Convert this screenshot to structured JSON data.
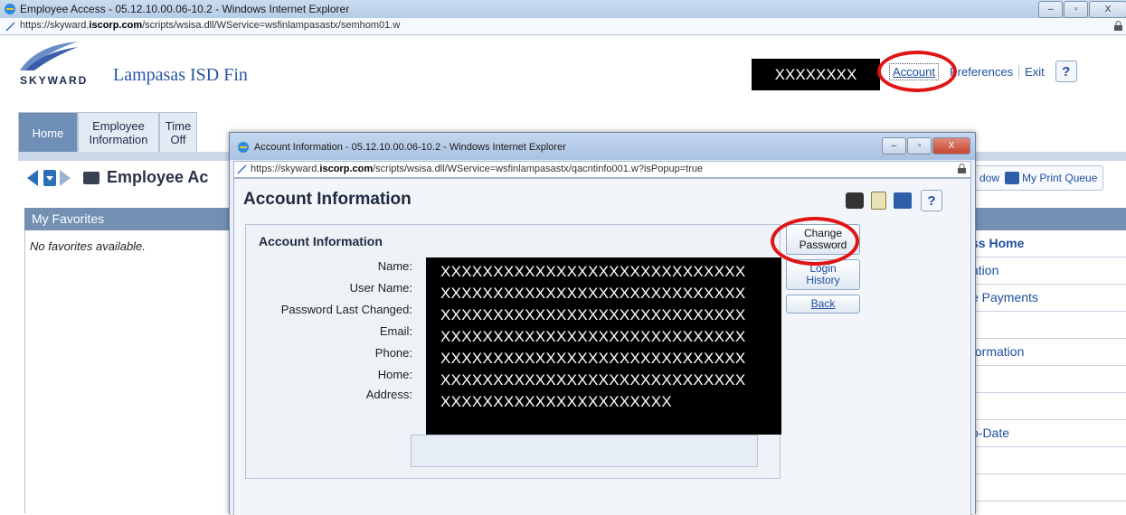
{
  "browser": {
    "window_title": "Employee Access - 05.12.10.00.06-10.2 - Windows Internet Explorer",
    "url_prefix": "https://skyward.",
    "url_host": "iscorp.com",
    "url_rest": "/scripts/wsisa.dll/WService=wsfinlampasastx/semhom01.w",
    "minimize": "–",
    "maximize": "▫",
    "close": "X"
  },
  "header": {
    "brand": "SKYWARD",
    "district": "Lampasas ISD Fin",
    "redacted_user": "XXXXXXXX",
    "links": {
      "account": "Account",
      "preferences": "Preferences",
      "exit": "Exit",
      "help": "?"
    }
  },
  "tabs": [
    {
      "label": "Home"
    },
    {
      "label": "Employee\nInformation"
    },
    {
      "label": "Time\nOff"
    }
  ],
  "breadcrumb": {
    "title": "Employee Ac"
  },
  "print_links": {
    "window": "dow",
    "queue": "My Print Queue"
  },
  "favorites": {
    "title": "My Favorites",
    "empty": "No favorites available."
  },
  "right_panel": {
    "items": [
      "ss Home",
      "ation",
      "e Payments",
      "",
      "formation",
      "",
      "",
      "o-Date",
      "",
      ""
    ]
  },
  "popup": {
    "window_title": "Account Information - 05.12.10.00.06-10.2 - Windows Internet Explorer",
    "url_prefix": "https://skyward.",
    "url_host": "iscorp.com",
    "url_rest": "/scripts/wsisa.dll/WService=wsfinlampasastx/qacntinfo001.w?isPopup=true",
    "heading": "Account Information",
    "help": "?",
    "group_title": "Account Information",
    "fields": {
      "name": "Name:",
      "username": "User Name:",
      "password_changed": "Password Last Changed:",
      "email": "Email:",
      "phone": "Phone:",
      "home": "Home:",
      "address": "Address:"
    },
    "redacted_lines": [
      "XXXXXXXXXXXXXXXXXXXXXXXXXXXXX",
      "XXXXXXXXXXXXXXXXXXXXXXXXXXXXX",
      "XXXXXXXXXXXXXXXXXXXXXXXXXXXXX",
      "XXXXXXXXXXXXXXXXXXXXXXXXXXXXX",
      "XXXXXXXXXXXXXXXXXXXXXXXXXXXXX",
      "XXXXXXXXXXXXXXXXXXXXXXXXXXXXX",
      "XXXXXXXXXXXXXXXXXXXXXX"
    ],
    "buttons": {
      "change_password_1": "Change",
      "change_password_2": "Password",
      "login_history_1": "Login",
      "login_history_2": "History",
      "back": "Back"
    }
  },
  "colors": {
    "annotation_ring": "#e01414",
    "header_bar": "#7390b3",
    "link": "#1f4fa0"
  }
}
